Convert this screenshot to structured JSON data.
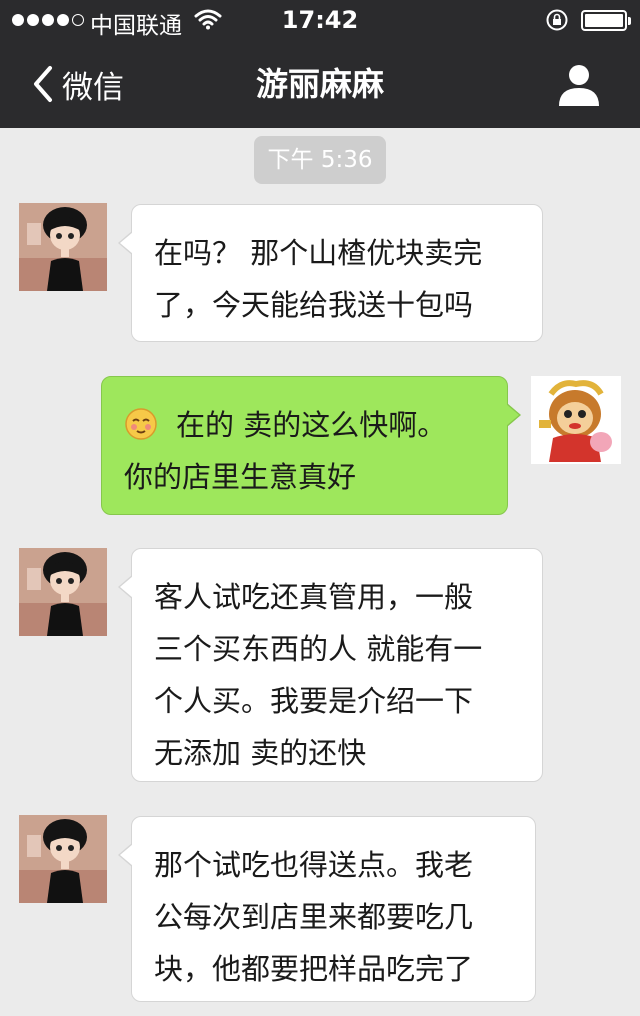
{
  "status_bar": {
    "carrier": "中国联通",
    "time": "17:42",
    "signal_strength": 4,
    "battery_level": 1.0
  },
  "nav": {
    "back_label": "微信",
    "title": "游丽麻麻",
    "icons": {
      "back": "chevron-left-icon",
      "profile": "person-icon"
    }
  },
  "chat": {
    "time_divider": "下午 5:36",
    "messages": [
      {
        "sender": "contact",
        "lines": [
          "在吗？ 那个山楂优块卖完",
          "了，今天能给我送十包吗"
        ]
      },
      {
        "sender": "self",
        "emoji": "shy-smile-emoji",
        "lines": [
          "在的 卖的这么快啊。",
          "你的店里生意真好"
        ]
      },
      {
        "sender": "contact",
        "lines": [
          "客人试吃还真管用，一般",
          "三个买东西的人 就能有一",
          "个人买。我要是介绍一下",
          "无添加  卖的还快"
        ]
      },
      {
        "sender": "contact",
        "lines": [
          "那个试吃也得送点。我老",
          "公每次到店里来都要吃几",
          "块，他都要把样品吃完了"
        ]
      }
    ]
  },
  "colors": {
    "header_bg": "#2b2b2d",
    "chat_bg": "#ebebeb",
    "outgoing_bubble": "#9ee75c",
    "incoming_bubble": "#ffffff",
    "time_badge": "#cecece"
  }
}
